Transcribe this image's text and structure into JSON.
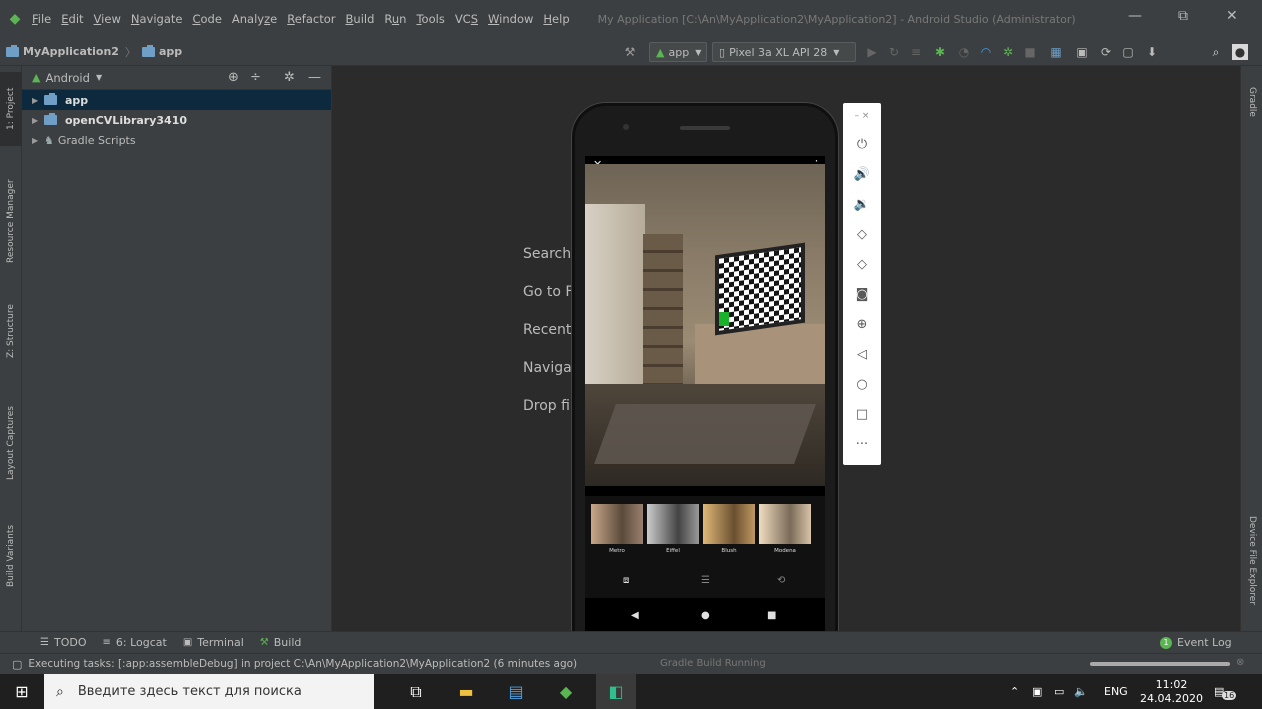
{
  "menubar": {
    "items": [
      {
        "pre": "",
        "u": "F",
        "post": "ile"
      },
      {
        "pre": "",
        "u": "E",
        "post": "dit"
      },
      {
        "pre": "",
        "u": "V",
        "post": "iew"
      },
      {
        "pre": "",
        "u": "N",
        "post": "avigate"
      },
      {
        "pre": "",
        "u": "C",
        "post": "ode"
      },
      {
        "pre": "Analy",
        "u": "z",
        "post": "e"
      },
      {
        "pre": "",
        "u": "R",
        "post": "efactor"
      },
      {
        "pre": "",
        "u": "B",
        "post": "uild"
      },
      {
        "pre": "R",
        "u": "u",
        "post": "n"
      },
      {
        "pre": "",
        "u": "T",
        "post": "ools"
      },
      {
        "pre": "VC",
        "u": "S",
        "post": ""
      },
      {
        "pre": "",
        "u": "W",
        "post": "indow"
      },
      {
        "pre": "",
        "u": "H",
        "post": "elp"
      }
    ],
    "title": "My Application [C:\\An\\MyApplication2\\MyApplication2] - Android Studio (Administrator)"
  },
  "navbar": {
    "project": "MyApplication2",
    "module": "app",
    "run_config": "app",
    "device": "Pixel 3a XL API 28"
  },
  "leftstrip": {
    "project": "1: Project",
    "resource": "Resource Manager",
    "structure": "Z: Structure",
    "layout": "Layout Captures",
    "variants": "Build Variants"
  },
  "rightstrip": {
    "gradle": "Gradle",
    "device_explorer": "Device File Explorer"
  },
  "project": {
    "view": "Android",
    "tree": [
      "app",
      "openCVLibrary3410",
      "Gradle Scripts"
    ]
  },
  "editor": {
    "hints": [
      "Search",
      "Go to F",
      "Recent",
      "Navigat",
      "Drop fil"
    ]
  },
  "phone": {
    "filters": [
      "Metro",
      "Eiffel",
      "Blush",
      "Modena"
    ]
  },
  "bottomtabs": {
    "todo": "TODO",
    "logcat": "6: Logcat",
    "terminal": "Terminal",
    "build": "Build",
    "eventlog": "Event Log",
    "eventcount": "1"
  },
  "statusbar": {
    "message": "Executing tasks: [:app:assembleDebug] in project C:\\An\\MyApplication2\\MyApplication2 (6 minutes ago)",
    "background_task": "Gradle Build Running"
  },
  "taskbar": {
    "search_placeholder": "Введите здесь текст для поиска",
    "lang": "ENG",
    "time": "11:02",
    "date": "24.04.2020",
    "notifications": "16"
  },
  "colors": {
    "ide_bg": "#2b2b2b",
    "panel_bg": "#3c3f41",
    "selection": "#0d293e",
    "android_green": "#5ab552"
  }
}
